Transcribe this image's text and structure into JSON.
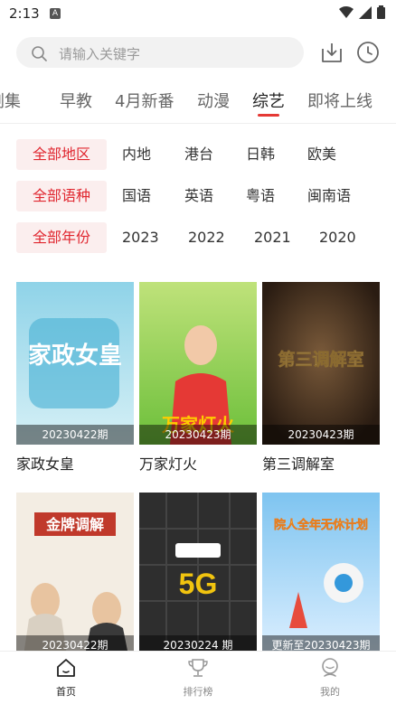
{
  "status_bar": {
    "time": "2:13"
  },
  "search": {
    "placeholder": "请输入关键字"
  },
  "tabs": [
    {
      "label": "剧集"
    },
    {
      "label": "早教"
    },
    {
      "label": "4月新番"
    },
    {
      "label": "动漫"
    },
    {
      "label": "综艺"
    },
    {
      "label": "即将上线"
    }
  ],
  "filters": {
    "region": [
      "全部地区",
      "内地",
      "港台",
      "日韩",
      "欧美"
    ],
    "language": [
      "全部语种",
      "国语",
      "英语",
      "粤语",
      "闽南语"
    ],
    "year": [
      "全部年份",
      "2023",
      "2022",
      "2021",
      "2020"
    ]
  },
  "cards": [
    {
      "title": "家政女皇",
      "episode": "20230422期",
      "poster_text": "家政女皇",
      "colors": [
        "#8fd3e8",
        "#d6f0f6"
      ]
    },
    {
      "title": "万家灯火",
      "episode": "20230423期",
      "poster_text": "万家灯火",
      "colors": [
        "#6cbf3a",
        "#bfe27a"
      ]
    },
    {
      "title": "第三调解室",
      "episode": "20230423期",
      "poster_text": "第三调解室",
      "colors": [
        "#3a2a1f",
        "#7a5a3a"
      ]
    },
    {
      "title": "",
      "episode": "20230422期",
      "poster_text": "金牌调解",
      "colors": [
        "#f3ede3",
        "#c9b79c"
      ]
    },
    {
      "title": "",
      "episode": "20230224 期",
      "poster_text": "5G",
      "colors": [
        "#2a2a2a",
        "#555555"
      ]
    },
    {
      "title": "",
      "episode": "更新至20230423期",
      "poster_text": "院人全年无休计划",
      "colors": [
        "#7ec4f0",
        "#dcefff"
      ]
    }
  ],
  "bottom_nav": [
    {
      "label": "首页"
    },
    {
      "label": "排行榜"
    },
    {
      "label": "我的"
    }
  ]
}
